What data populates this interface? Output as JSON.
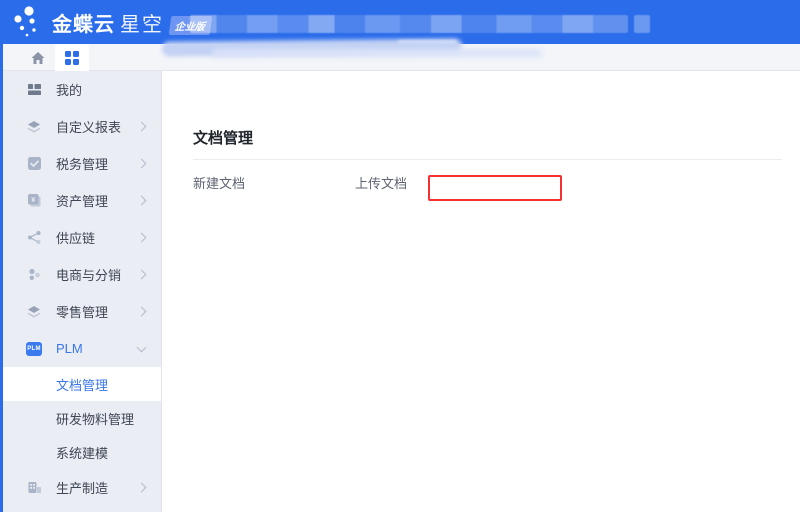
{
  "header": {
    "brand_bold": "金蝶云",
    "brand_light": "星空",
    "edition_badge": "企业版"
  },
  "tabbar": {
    "icons": [
      "home-icon",
      "apps-grid-icon"
    ]
  },
  "sidebar": {
    "items": [
      {
        "label": "我的",
        "icon": "briefcase-grid-icon",
        "has_children": false
      },
      {
        "label": "自定义报表",
        "icon": "layers-icon",
        "has_children": true
      },
      {
        "label": "税务管理",
        "icon": "check-square-icon",
        "has_children": true
      },
      {
        "label": "资产管理",
        "icon": "asset-cards-icon",
        "has_children": true
      },
      {
        "label": "供应链",
        "icon": "share-network-icon",
        "has_children": true
      },
      {
        "label": "电商与分销",
        "icon": "cluster-dots-icon",
        "has_children": true
      },
      {
        "label": "零售管理",
        "icon": "layers-icon",
        "has_children": true
      },
      {
        "label": "PLM",
        "badge": "PLM",
        "icon": "plm-badge-icon",
        "has_children": true,
        "expanded": true,
        "children": [
          {
            "label": "文档管理",
            "active": true
          },
          {
            "label": "研发物料管理",
            "active": false
          },
          {
            "label": "系统建模",
            "active": false
          }
        ]
      },
      {
        "label": "生产制造",
        "icon": "factory-icon",
        "has_children": true
      }
    ]
  },
  "content": {
    "page_title": "文档管理",
    "links": [
      {
        "label": "新建文档"
      },
      {
        "label": "上传文档",
        "highlighted": true
      }
    ]
  },
  "colors": {
    "header_blue": "#2B6CEA",
    "accent_blue": "#3A77EC",
    "sidebar_bg": "#EAEDF3",
    "tabbar_bg": "#F3F5F9",
    "highlight_red": "#F53030"
  }
}
